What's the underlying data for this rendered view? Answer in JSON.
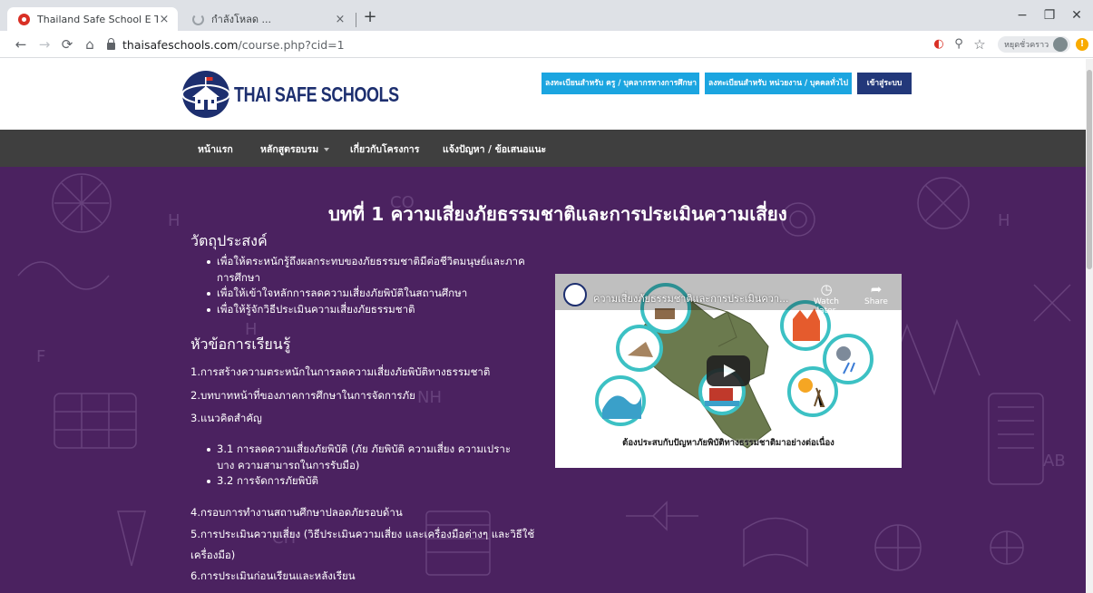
{
  "browser": {
    "tabs": [
      {
        "title": "Thailand Safe School E Training",
        "state": "active"
      },
      {
        "title": "กำลังโหลด ...",
        "state": "loading"
      }
    ],
    "close_glyph": "×",
    "new_tab_glyph": "+",
    "window_controls": {
      "minimize": "−",
      "restore": "❐",
      "close": "✕"
    },
    "nav": {
      "back": "←",
      "forward": "→",
      "reload": "⟳",
      "home": "⌂"
    },
    "url_domain": "thaisafeschools.com",
    "url_path": "/course.php?cid=1",
    "toolbar_icons": {
      "extension": "◐",
      "zoom": "⚲",
      "bookmark": "☆"
    },
    "profile_label": "หยุดชั่วคราว",
    "update_badge": "!"
  },
  "site": {
    "logo_text": "THAI SAFE SCHOOLS",
    "header_buttons": [
      {
        "label": "ลงทะเบียนสำหรับ ครู / บุคลากรทางการศึกษา",
        "style": "cyan"
      },
      {
        "label": "ลงทะเบียนสำหรับ หน่วยงาน / บุคคลทั่วไป",
        "style": "cyan"
      },
      {
        "label": "เข้าสู่ระบบ",
        "style": "navy"
      }
    ],
    "nav_items": [
      {
        "label": "หน้าแรก"
      },
      {
        "label": "หลักสูตรอบรม",
        "dropdown": true
      },
      {
        "label": "เกี่ยวกับโครงการ"
      },
      {
        "label": "แจ้งปัญหา / ข้อเสนอแนะ"
      }
    ],
    "colors": {
      "purple": "#4b2260",
      "nav": "#3f3f3f",
      "cyan": "#1ba5e0",
      "navy": "#22387a"
    }
  },
  "lesson": {
    "title": "บทที่ 1 ความเสี่ยงภัยธรรมชาติและการประเมินความเสี่ยง",
    "objectives_heading": "วัตถุประสงค์",
    "objectives": [
      "เพื่อให้ตระหนักรู้ถึงผลกระทบของภัยธรรมชาติมีต่อชีวิตมนุษย์และภาคการศึกษา",
      "เพื่อให้เข้าใจหลักการลดความเสี่ยงภัยพิบัติในสถานศึกษา",
      "เพื่อให้รู้จักวิธีประเมินความเสี่ยงภัยธรรมชาติ"
    ],
    "topics_heading": "หัวข้อการเรียนรู้",
    "topics": [
      "1.การสร้างความตระหนักในการลดความเสี่ยงภัยพิบัติทางธรรมชาติ",
      "2.บทบาทหน้าที่ของภาคการศึกษาในการจัดการภัย",
      "3.แนวคิดสำคัญ"
    ],
    "subtopics": [
      "3.1 การลดความเสี่ยงภัยพิบัติ (ภัย ภัยพิบัติ ความเสี่ยง ความเปราะบาง ความสามารถในการรับมือ)",
      "3.2 การจัดการภัยพิบัติ"
    ],
    "topic_4": "4.กรอบการทำงานสถานศึกษาปลอดภัยรอบด้าน",
    "topic_5a": "5.การประเมินความเสี่ยง (วิธีประเมินความเสี่ยง และเครื่องมือต่างๆ และวิธีใช้",
    "topic_5b": "เครื่องมือ)",
    "topic_6": "6.การประเมินก่อนเรียนและหลังเรียน"
  },
  "video": {
    "title": "ความเสี่ยงภัยธรรมชาติและการประเมินควา...",
    "watch_later": "Watch later",
    "share": "Share",
    "watch_later_icon": "clock-icon",
    "share_icon": "share-icon",
    "caption": "ต้องประสบกับปัญหาภัยพิบัติทางธรรมชาติมาอย่างต่อเนื่อง"
  }
}
